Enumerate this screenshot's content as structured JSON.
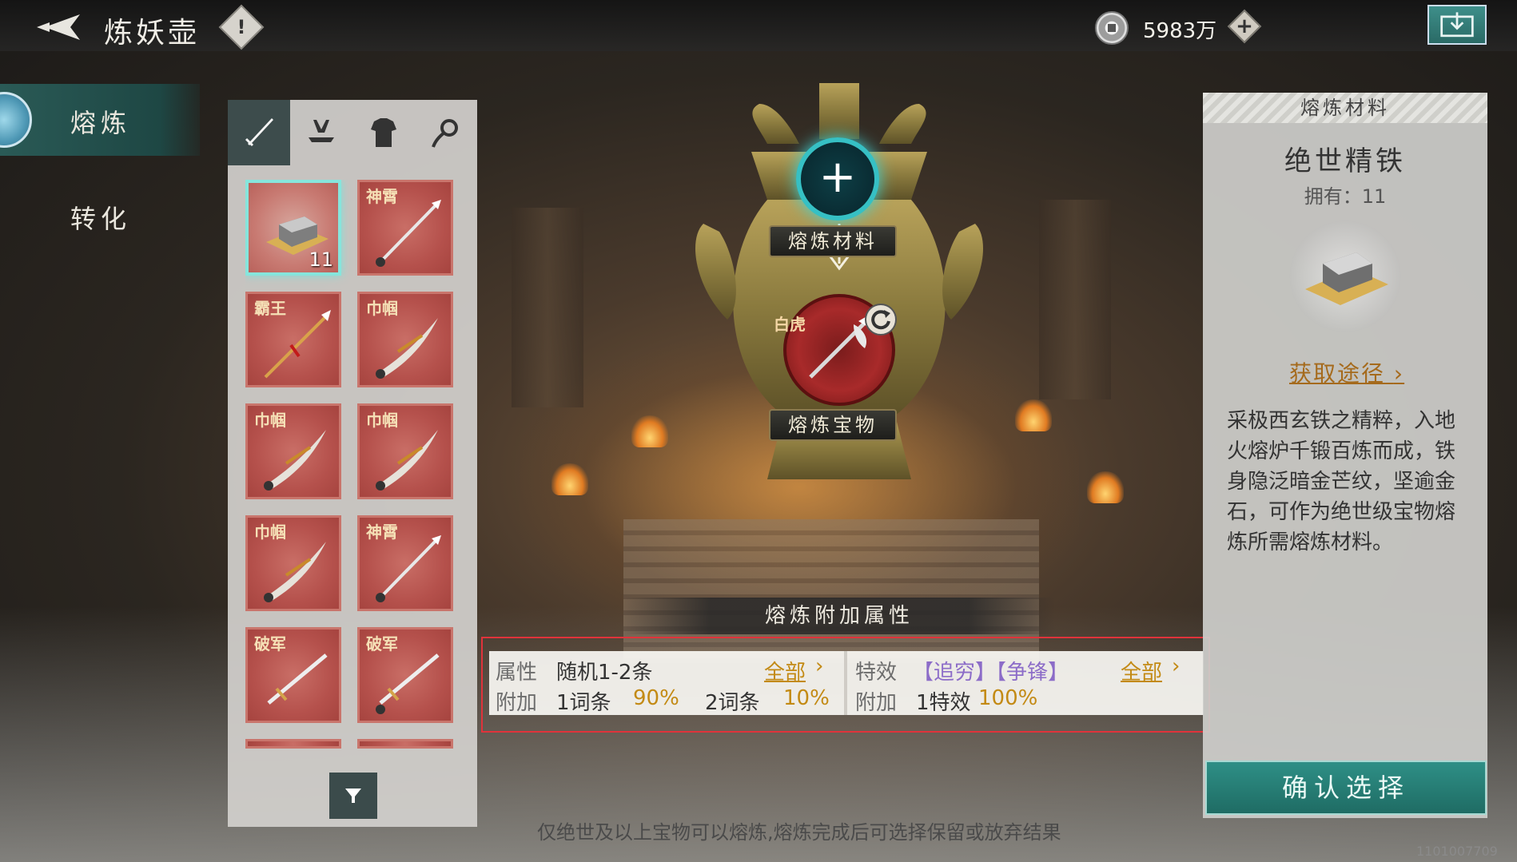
{
  "header": {
    "title": "炼妖壶",
    "info_label": "!",
    "currency_amount": "5983万",
    "currency_add_label": "+"
  },
  "leftnav": {
    "items": [
      {
        "label": "熔炼",
        "active": true
      },
      {
        "label": "转化",
        "active": false
      }
    ]
  },
  "item_tabs": [
    "sword-tab-icon",
    "hat-tab-icon",
    "armor-tab-icon",
    "accessory-tab-icon"
  ],
  "items": [
    {
      "tag": "",
      "count": "11",
      "icon": "iron-ingot-icon",
      "selected": true
    },
    {
      "tag": "神霄",
      "count": "",
      "icon": "spear-icon"
    },
    {
      "tag": "霸王",
      "count": "",
      "icon": "spear-icon"
    },
    {
      "tag": "巾帼",
      "count": "",
      "icon": "blade-icon"
    },
    {
      "tag": "巾帼",
      "count": "",
      "icon": "blade-icon"
    },
    {
      "tag": "巾帼",
      "count": "",
      "icon": "blade-icon"
    },
    {
      "tag": "巾帼",
      "count": "",
      "icon": "blade-icon"
    },
    {
      "tag": "神霄",
      "count": "",
      "icon": "spear-icon"
    },
    {
      "tag": "破军",
      "count": "",
      "icon": "sword-icon"
    },
    {
      "tag": "破军",
      "count": "",
      "icon": "sword-icon"
    }
  ],
  "vessel": {
    "material_label": "熔炼材料",
    "treasure_label": "熔炼宝物",
    "treasure_tag": "白虎",
    "add_symbol": "+"
  },
  "attributes": {
    "header": "熔炼附加属性",
    "left": {
      "row1_key": "属性",
      "row1_value": "随机1-2条",
      "row1_link": "全部",
      "row2_key": "附加",
      "row2_a": "1词条",
      "row2_a_pct": "90%",
      "row2_b": "2词条",
      "row2_b_pct": "10%"
    },
    "right": {
      "row1_key": "特效",
      "row1_value": "【追穷】【争锋】",
      "row1_link": "全部",
      "row2_key": "附加",
      "row2_a": "1特效",
      "row2_a_pct": "100%"
    }
  },
  "material_panel": {
    "header": "熔炼材料",
    "name": "绝世精铁",
    "owned": "拥有：11",
    "acquire": "获取途径",
    "description": "采极西玄铁之精粹，入地火熔炉千锻百炼而成，铁身隐泛暗金芒纹，坚逾金石，可作为绝世级宝物熔炼所需熔炼材料。"
  },
  "confirm_label": "确认选择",
  "hint": "仅绝世及以上宝物可以熔炼,熔炼完成后可选择保留或放弃结果",
  "code": "1101007709",
  "colors": {
    "accent_teal": "#2e8f86",
    "item_red": "#b5514c",
    "gold_text": "#c38a14",
    "highlight_border": "#e0333b"
  }
}
